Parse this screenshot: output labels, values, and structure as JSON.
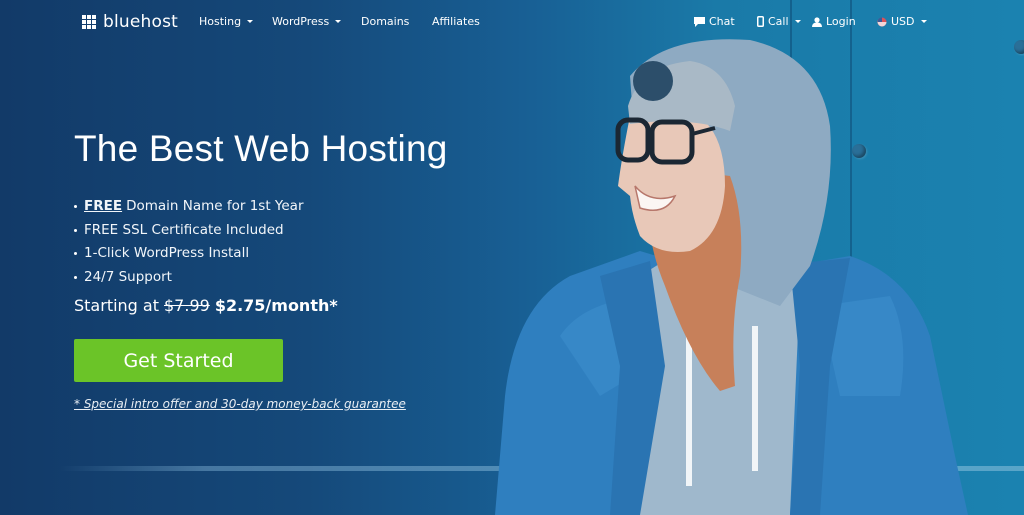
{
  "brand": {
    "name": "bluehost",
    "logo_icon": "grid-icon"
  },
  "nav": {
    "items": [
      {
        "label": "Hosting",
        "has_dropdown": true
      },
      {
        "label": "WordPress",
        "has_dropdown": true
      },
      {
        "label": "Domains",
        "has_dropdown": false
      },
      {
        "label": "Affiliates",
        "has_dropdown": false
      }
    ],
    "utility": [
      {
        "label": "Chat",
        "icon": "chat-icon",
        "has_dropdown": false
      },
      {
        "label": "Call",
        "icon": "phone-icon",
        "has_dropdown": true
      },
      {
        "label": "Login",
        "icon": "user-icon",
        "has_dropdown": false
      },
      {
        "label": "USD",
        "icon": "us-flag-icon",
        "has_dropdown": true
      }
    ]
  },
  "hero": {
    "headline": "The Best Web Hosting",
    "features": [
      {
        "highlight": "FREE",
        "text": "Domain Name for 1st Year"
      },
      {
        "highlight": "",
        "text": "FREE SSL Certificate Included"
      },
      {
        "highlight": "",
        "text": "1-Click WordPress Install"
      },
      {
        "highlight": "",
        "text": "24/7 Support"
      }
    ],
    "price": {
      "prefix": "Starting at",
      "old_price": "$7.99",
      "new_price": "$2.75/month*"
    },
    "cta_label": "Get Started",
    "disclaimer": "* Special intro offer and 30-day money-back guarantee"
  },
  "colors": {
    "cta_green": "#6bc428",
    "background_dark": "#123a68",
    "background_light": "#1b82b0"
  }
}
